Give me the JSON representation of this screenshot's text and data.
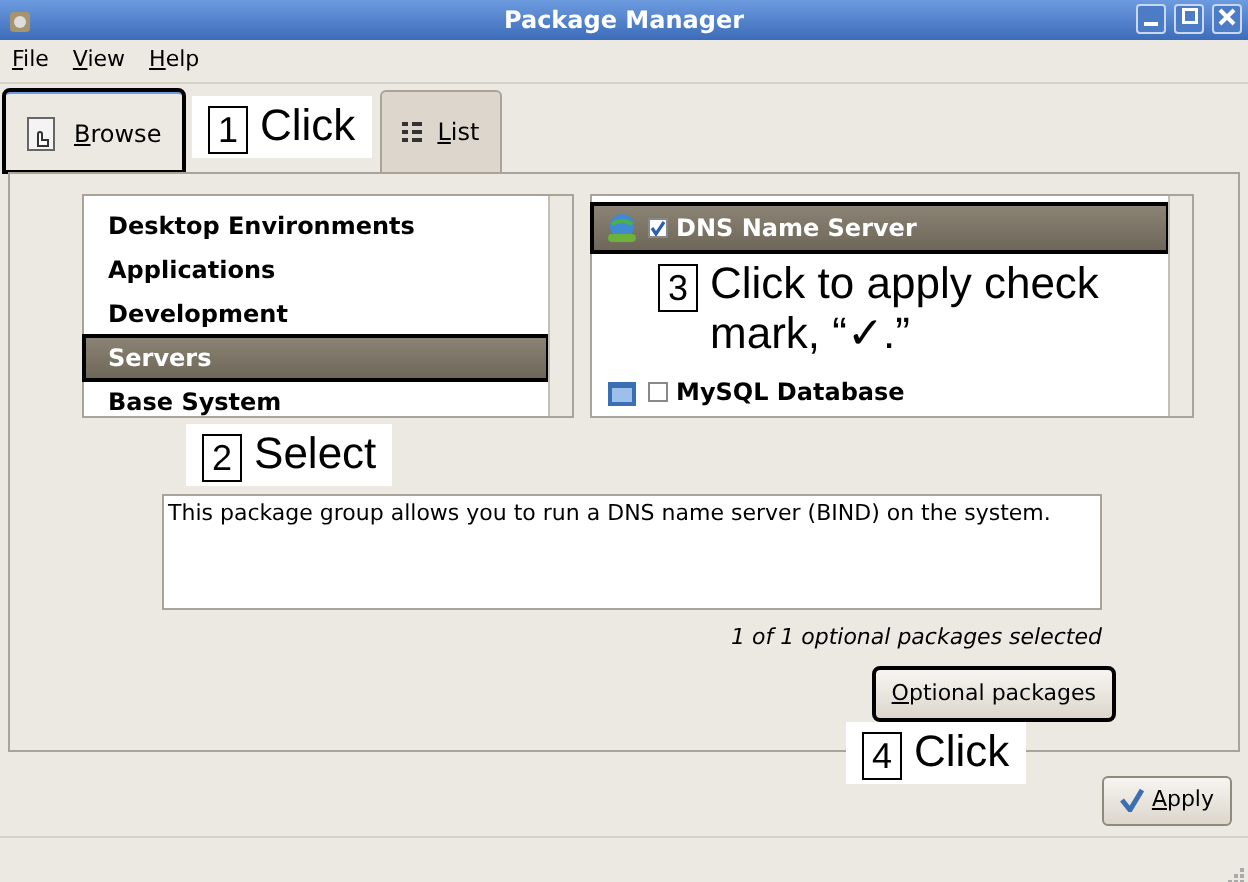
{
  "window": {
    "title": "Package Manager"
  },
  "menu": [
    "File",
    "View",
    "Help"
  ],
  "tabs": [
    {
      "label": "Browse",
      "selected": true,
      "highlighted": true
    },
    {
      "label": "List",
      "selected": false,
      "highlighted": false
    }
  ],
  "tabs_callout": {
    "number": "1",
    "text": "Click"
  },
  "groups": [
    {
      "label": "Desktop Environments",
      "selected": false,
      "highlighted": false
    },
    {
      "label": "Applications",
      "selected": false,
      "highlighted": false
    },
    {
      "label": "Development",
      "selected": false,
      "highlighted": false
    },
    {
      "label": "Servers",
      "selected": true,
      "highlighted": true
    },
    {
      "label": "Base System",
      "selected": false,
      "highlighted": false
    }
  ],
  "groups_callout": {
    "number": "2",
    "text": "Select"
  },
  "packages": [
    {
      "label": "DNS Name Server",
      "kind": "globe",
      "checked": true,
      "selected": true,
      "highlighted": true
    },
    {
      "label": "MySQL Database",
      "kind": "database",
      "checked": false,
      "selected": false,
      "highlighted": false
    }
  ],
  "packages_callout": {
    "number": "3",
    "text": "Click to apply check mark, “✓.”"
  },
  "description": "This package group allows you to run a DNS name server (BIND) on the system.",
  "selection_summary": "1 of 1 optional packages selected",
  "optional_button": {
    "label": "Optional packages",
    "highlighted": true
  },
  "optional_callout": {
    "number": "4",
    "text": "Click"
  },
  "apply_button": {
    "label": "Apply"
  }
}
